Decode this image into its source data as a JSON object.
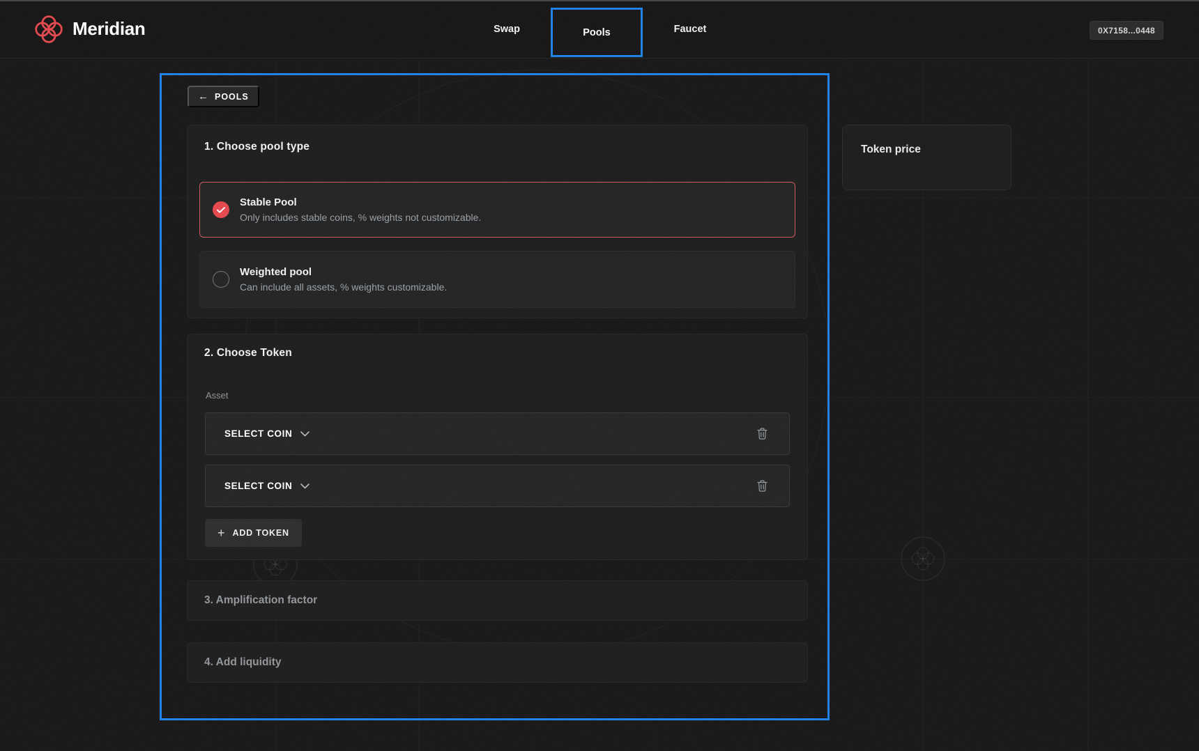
{
  "header": {
    "brand": "Meridian",
    "tabs": [
      {
        "label": "Swap"
      },
      {
        "label": "Pools"
      },
      {
        "label": "Faucet"
      }
    ],
    "active_tab": "Pools",
    "wallet_address": "0X7158...0448"
  },
  "main": {
    "back_button_label": "POOLS",
    "step1": {
      "title": "1. Choose pool type",
      "options": [
        {
          "name": "Stable Pool",
          "description": "Only includes stable coins, % weights not customizable.",
          "selected": true
        },
        {
          "name": "Weighted pool",
          "description": "Can include all assets, % weights customizable.",
          "selected": false
        }
      ]
    },
    "step2": {
      "title": "2. Choose Token",
      "asset_label": "Asset",
      "token_selects": [
        {
          "label": "SELECT COIN"
        },
        {
          "label": "SELECT COIN"
        }
      ],
      "add_token_label": "ADD TOKEN"
    },
    "step3": {
      "title": "3. Amplification factor"
    },
    "step4": {
      "title": "4. Add liquidity"
    }
  },
  "side_panel": {
    "title": "Token price"
  },
  "colors": {
    "accent_blue": "#1e80e8",
    "accent_red": "#e5484d",
    "background": "#171717"
  }
}
